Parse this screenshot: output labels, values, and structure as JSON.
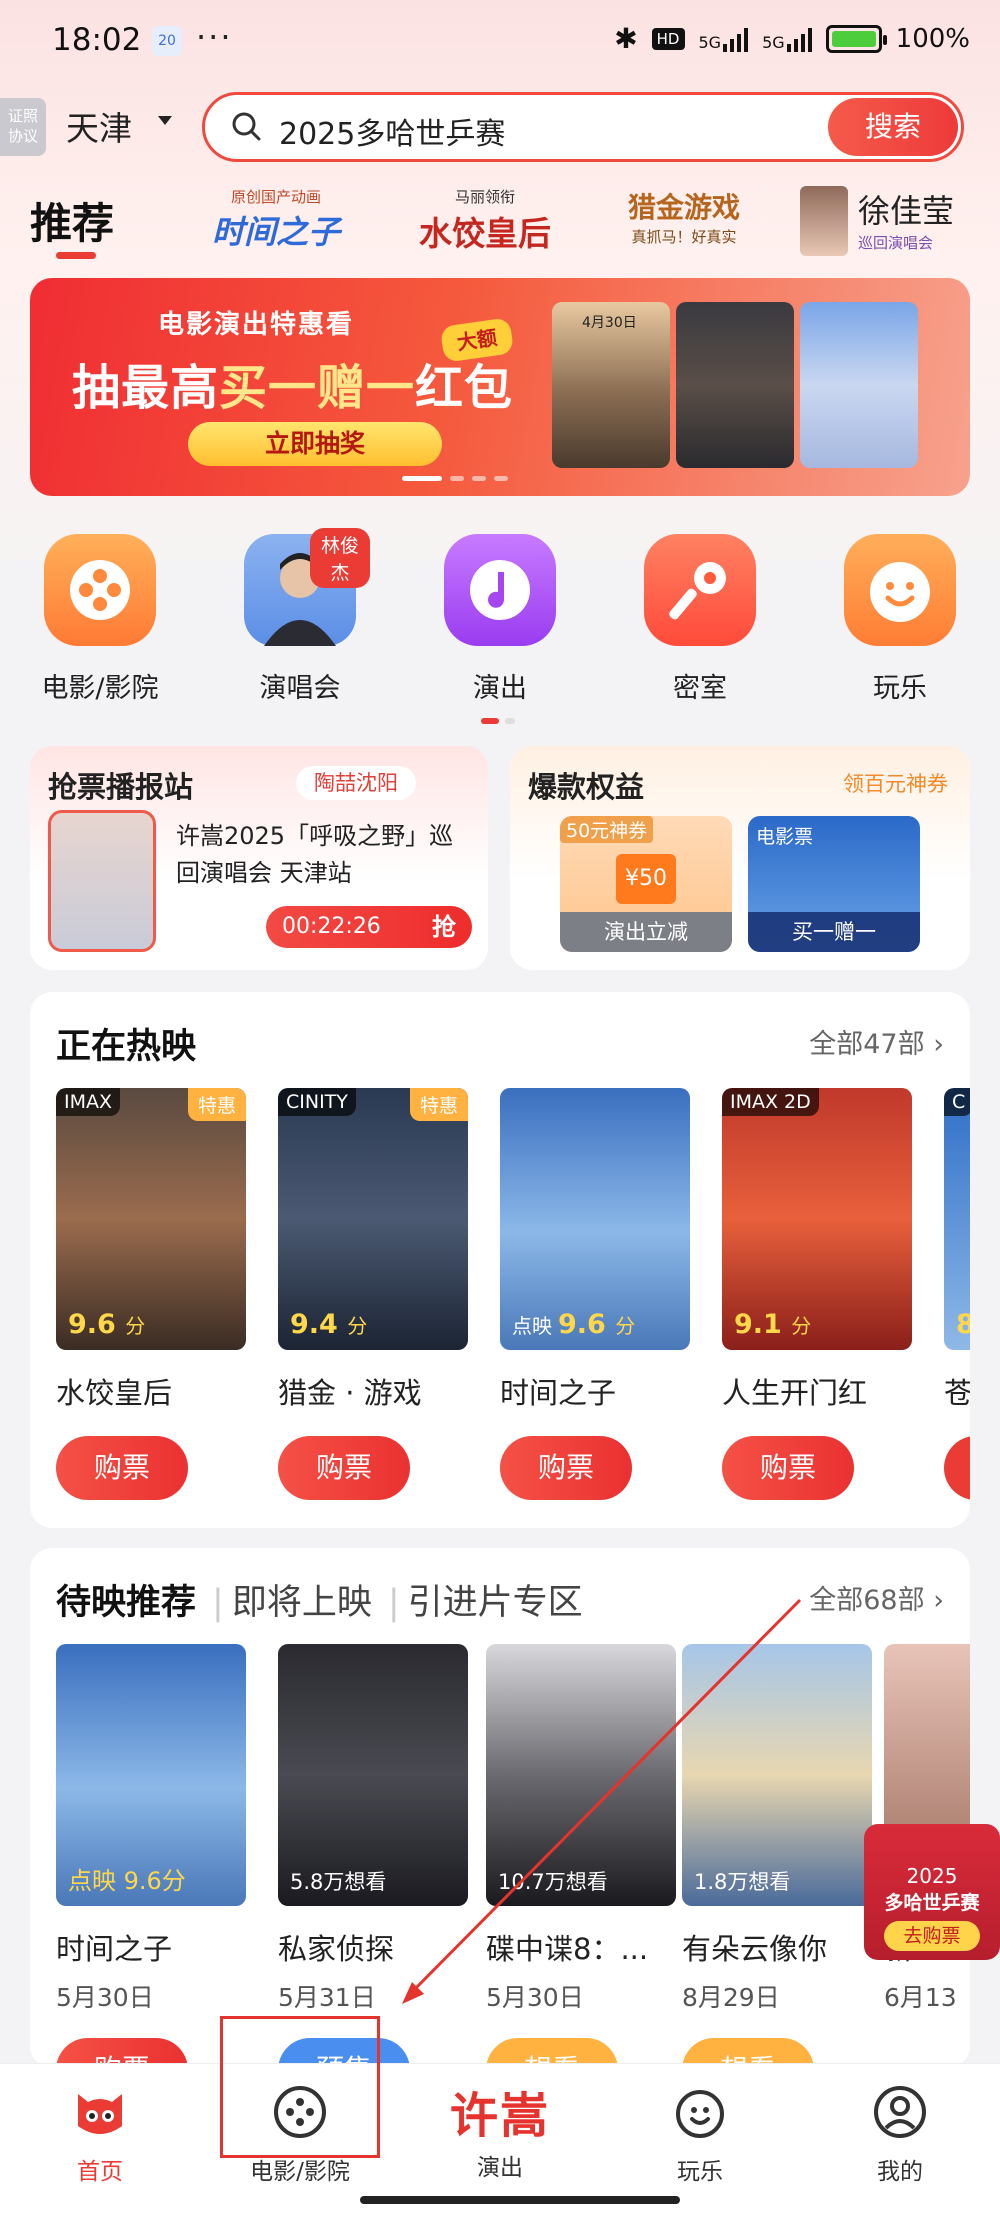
{
  "status_bar": {
    "time": "18:02",
    "date_badge": "20",
    "dots": "···",
    "battery_pct": "100%",
    "net1": "5G",
    "net2": "5G",
    "hd": "HD"
  },
  "left_tag": "证照\n协议",
  "search": {
    "city": "天津",
    "query": "2025多哈世乒赛",
    "button": "搜索"
  },
  "channels": {
    "recommend": "推荐",
    "items": [
      {
        "title": "时间之子",
        "sub": "原创国产动画"
      },
      {
        "title": "水饺皇后",
        "sub": "马丽领衔"
      },
      {
        "title": "猎金游戏",
        "sub": "真抓马！好真实"
      },
      {
        "title": "徐佳莹",
        "sub": "巡回演唱会"
      }
    ]
  },
  "banner": {
    "kicker": "电影演出特惠看",
    "headline_a": "抽最高",
    "headline_b": "买一赠一",
    "headline_c": "红包",
    "tag": "大额",
    "cta": "立即抽奖",
    "poster_date": "4月30日"
  },
  "categories": [
    {
      "label": "电影/影院",
      "icon": "film-reel-icon",
      "color": "#ff8a3d"
    },
    {
      "label": "演唱会",
      "icon": "avatar-icon",
      "tag": "林俊杰",
      "color": "#5b8ee6"
    },
    {
      "label": "演出",
      "icon": "music-note-icon",
      "color": "#a646f0"
    },
    {
      "label": "密室",
      "icon": "key-icon",
      "color": "#ff5a3a"
    },
    {
      "label": "玩乐",
      "icon": "smile-icon",
      "color": "#ff8a3d"
    }
  ],
  "promo_left": {
    "title": "抢票播报站",
    "chip": "陶喆沈阳",
    "desc": "许嵩2025「呼吸之野」巡回演唱会 天津站",
    "timer": "00:22:26",
    "grab": "抢"
  },
  "promo_right": {
    "title": "爆款权益",
    "chip": "领百元神券",
    "perk1_top": "50元神券",
    "perk1_value": "¥50",
    "perk1_caption": "演出立减",
    "perk2_top": "电影票",
    "perk2_caption": "买一赠一"
  },
  "hot": {
    "title": "正在热映",
    "more": "全部47部",
    "movies": [
      {
        "name": "水饺皇后",
        "badge_tl": "IMAX",
        "badge_tr": "特惠",
        "score": "9.6",
        "unit": "分",
        "buy": "购票"
      },
      {
        "name": "猎金 · 游戏",
        "badge_tl": "CINITY",
        "badge_tr": "特惠",
        "score": "9.4",
        "unit": "分",
        "buy": "购票"
      },
      {
        "name": "时间之子",
        "badge_tl": "",
        "badge_tr": "",
        "score": "9.6",
        "unit": "分",
        "pre": "点映",
        "buy": "购票"
      },
      {
        "name": "人生开门红",
        "badge_tl": "IMAX 2D",
        "badge_tr": "",
        "score": "9.1",
        "unit": "分",
        "buy": "购票"
      },
      {
        "name": "苍",
        "badge_tl": "C",
        "badge_tr": "",
        "score": "8",
        "unit": "",
        "buy": ""
      }
    ]
  },
  "upcoming": {
    "tab_active": "待映推荐",
    "tab2": "即将上映",
    "tab3": "引进片专区",
    "more": "全部68部",
    "movies": [
      {
        "name": "时间之子",
        "date": "5月30日",
        "overlay": "点映 9.6分",
        "btn": "购票"
      },
      {
        "name": "私家侦探",
        "date": "5月31日",
        "overlay": "5.8万想看",
        "btn": "预售"
      },
      {
        "name": "碟中谍8：...",
        "date": "5月30日",
        "overlay": "10.7万想看",
        "btn": "想看"
      },
      {
        "name": "有朵云像你",
        "date": "8月29日",
        "overlay": "1.8万想看",
        "btn": "想看"
      },
      {
        "name": "新",
        "date": "6月13",
        "overlay": "",
        "btn": ""
      }
    ]
  },
  "float_promo": {
    "year": "2025",
    "name": "多哈世乒赛",
    "buy": "去购票"
  },
  "bottom_nav": {
    "home": "首页",
    "movie": "电影/影院",
    "center_big": "许嵩",
    "center_label": "演出",
    "play": "玩乐",
    "mine": "我的"
  },
  "colors": {
    "accent": "#ea3b34",
    "orange": "#ff8a3d",
    "purple": "#a646f0",
    "gold": "#ffd74a"
  }
}
